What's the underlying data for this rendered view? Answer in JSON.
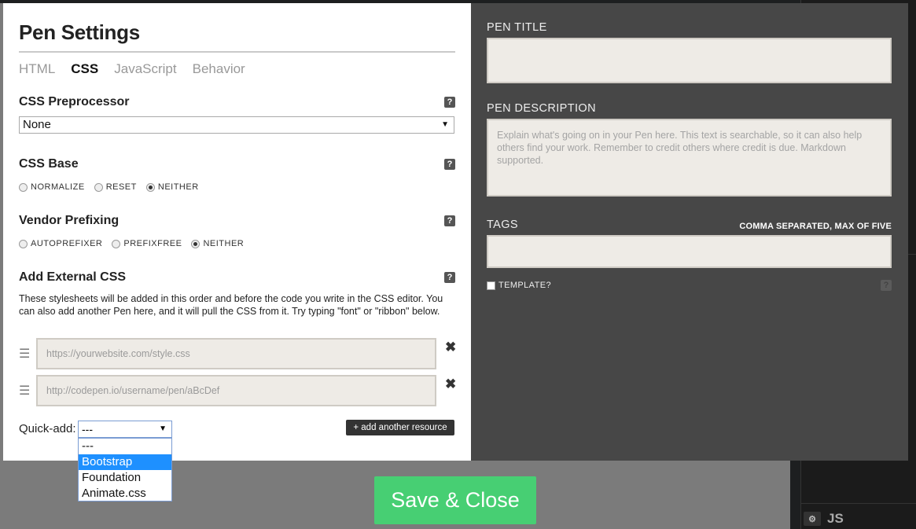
{
  "modal": {
    "title": "Pen Settings",
    "tabs": [
      {
        "label": "HTML",
        "active": false
      },
      {
        "label": "CSS",
        "active": true
      },
      {
        "label": "JavaScript",
        "active": false
      },
      {
        "label": "Behavior",
        "active": false
      }
    ],
    "help_glyph": "?"
  },
  "css_preprocessor": {
    "heading": "CSS Preprocessor",
    "selected": "None"
  },
  "css_base": {
    "heading": "CSS Base",
    "options": [
      {
        "label": "NORMALIZE",
        "checked": false
      },
      {
        "label": "RESET",
        "checked": false
      },
      {
        "label": "NEITHER",
        "checked": true
      }
    ]
  },
  "vendor_prefixing": {
    "heading": "Vendor Prefixing",
    "options": [
      {
        "label": "AUTOPREFIXER",
        "checked": false
      },
      {
        "label": "PREFIXFREE",
        "checked": false
      },
      {
        "label": "NEITHER",
        "checked": true
      }
    ]
  },
  "external_css": {
    "heading": "Add External CSS",
    "description": "These stylesheets will be added in this order and before the code you write in the CSS editor. You can also add another Pen here, and it will pull the CSS from it. Try typing \"font\" or \"ribbon\" below.",
    "resources": [
      {
        "placeholder": "https://yourwebsite.com/style.css",
        "value": ""
      },
      {
        "placeholder": "http://codepen.io/username/pen/aBcDef",
        "value": ""
      }
    ],
    "quick_add_label": "Quick-add:",
    "quick_add_selected": "---",
    "quick_add_options": [
      "---",
      "Bootstrap",
      "Foundation",
      "Animate.css"
    ],
    "quick_add_highlighted": "Bootstrap",
    "add_resource_label": "+ add another resource"
  },
  "pen_info": {
    "title_label": "PEN TITLE",
    "title_value": "",
    "description_label": "PEN DESCRIPTION",
    "description_placeholder": "Explain what's going on in your Pen here. This text is searchable, so it can also help others find your work. Remember to credit others where credit is due. Markdown supported.",
    "tags_label": "TAGS",
    "tags_hint": "COMMA SEPARATED, MAX OF FIVE",
    "tags_value": "",
    "template_label": "TEMPLATE?",
    "template_checked": false
  },
  "save_button": "Save & Close",
  "background_editor": {
    "js_label": "JS",
    "gear_icon": "gear-icon"
  },
  "colors": {
    "save_green": "#47cf73",
    "dark_panel": "#474747",
    "input_bg": "#eeebe6",
    "dropdown_highlight": "#1e90ff"
  }
}
